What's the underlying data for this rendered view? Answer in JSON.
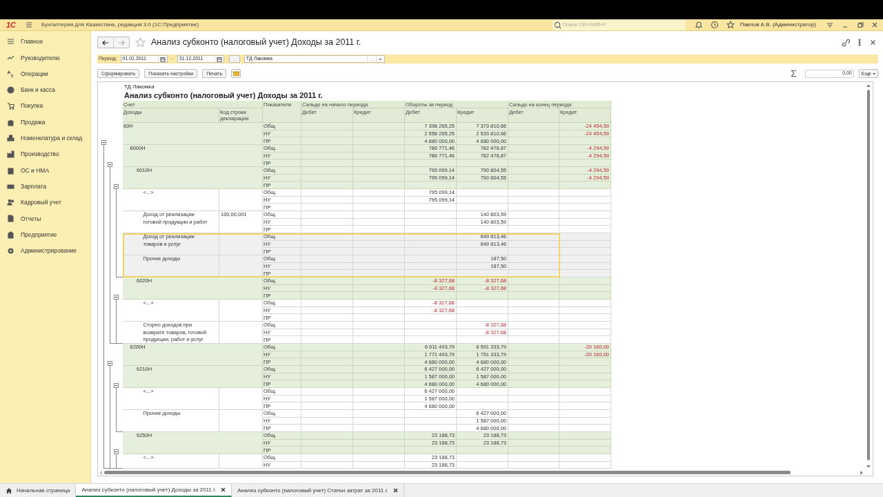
{
  "app": {
    "logo": "1С",
    "title": "Бухгалтерия для Казахстана, редакция 3.0  (1С:Предприятие)",
    "search_placeholder": "Поиск Ctrl+Shift+F",
    "user": "Павлов А.В. (Администратор)"
  },
  "sidebar": {
    "items": [
      {
        "label": "Главное"
      },
      {
        "label": "Руководителю"
      },
      {
        "label": "Операции"
      },
      {
        "label": "Банк и касса"
      },
      {
        "label": "Покупка"
      },
      {
        "label": "Продажа"
      },
      {
        "label": "Номенклатура и склад"
      },
      {
        "label": "Производство"
      },
      {
        "label": "ОС и НМА"
      },
      {
        "label": "Зарплата"
      },
      {
        "label": "Кадровый учет"
      },
      {
        "label": "Отчеты"
      },
      {
        "label": "Предприятие"
      },
      {
        "label": "Администрирование"
      }
    ]
  },
  "form": {
    "title": "Анализ субконто (налоговый учет) Доходы  за 2011 г.",
    "period_label": "Период:",
    "date_from": "01.01.2011",
    "date_separator": "-",
    "date_to": "31.12.2011",
    "period_button": "...",
    "subconto": "ТД Лакомка",
    "choose_glyph": "...",
    "clear_glyph": "×",
    "buttons": [
      "Сформировать",
      "Показать настройки",
      "Печать"
    ],
    "sum_value": "0,00",
    "more": "Еще"
  },
  "report": {
    "org": "ТД Лакомка",
    "title": "Анализ субконто (налоговый учет) Доходы  за 2011 г.",
    "header": {
      "account": "Счет",
      "name": "Доходы",
      "code": "Код строки декларации",
      "indicators": "Показатели",
      "sections": [
        {
          "title": "Сальдо на начало периода",
          "debit": "Дебет",
          "credit": "Кредит"
        },
        {
          "title": "Обороты за период",
          "debit": "Дебет",
          "credit": "Кредит"
        },
        {
          "title": "Сальдо на конец периода",
          "debit": "Дебет",
          "credit": "Кредит"
        }
      ]
    },
    "rows": [
      {
        "name": "60Н",
        "selected": false,
        "expanded": true,
        "lines": [
          {
            "label": "Общ.",
            "values": {
              "ob_d": "7 398 265,25",
              "ob_k": "7 373 810,66"
            },
            "red_values": {
              "sk_k": "-24 454,59"
            }
          },
          {
            "label": "НУ",
            "values": {
              "ob_d": "2 558 265,25",
              "ob_k": "2 533 810,66"
            },
            "red_values": {
              "sk_k": "-24 454,59"
            }
          },
          {
            "label": "ПР",
            "values": {
              "ob_d": "4 680 000,00",
              "ob_k": "4 680 000,00"
            }
          }
        ],
        "children": [
          {
            "name": "6000Н",
            "selected": false,
            "expanded": true,
            "lines": [
              {
                "label": "Общ.",
                "values": {
                  "ob_d": "786 771,46",
                  "ob_k": "782 476,87"
                },
                "red_values": {
                  "sk_k": "-4 294,59"
                }
              },
              {
                "label": "НУ",
                "values": {
                  "ob_d": "786 771,46",
                  "ob_k": "782 476,87"
                },
                "red_values": {
                  "sk_k": "-4 294,59"
                }
              },
              {
                "label": "ПР"
              }
            ],
            "children": [
              {
                "name": "6010Н",
                "selected": false,
                "expanded": true,
                "lines": [
                  {
                    "label": "Общ.",
                    "values": {
                      "ob_d": "795 099,14",
                      "ob_k": "790 804,55"
                    },
                    "red_values": {
                      "sk_k": "-4 294,59"
                    }
                  },
                  {
                    "label": "НУ",
                    "values": {
                      "ob_d": "795 099,14",
                      "ob_k": "790 804,55"
                    },
                    "red_values": {
                      "sk_k": "-4 294,59"
                    }
                  },
                  {
                    "label": "ПР"
                  }
                ],
                "children": [
                  {
                    "name": "<...>",
                    "selected": false,
                    "lines": [
                      {
                        "label": "Общ.",
                        "values": {
                          "ob_d": "795 099,14"
                        }
                      },
                      {
                        "label": "НУ",
                        "values": {
                          "ob_d": "795 099,14"
                        }
                      },
                      {
                        "label": "ПР"
                      }
                    ]
                  },
                  {
                    "name": "Доход от реализации готовой продукции и работ",
                    "code": "100.00.001",
                    "selected": false,
                    "lines": [
                      {
                        "label": "Общ.",
                        "values": {
                          "ob_k": "140 803,59"
                        }
                      },
                      {
                        "label": "НУ",
                        "values": {
                          "ob_k": "140 803,59"
                        }
                      },
                      {
                        "label": "ПР"
                      }
                    ]
                  },
                  {
                    "name": "Доход от реализации товаров и услуг",
                    "selected": true,
                    "lines": [
                      {
                        "label": "Общ.",
                        "values": {
                          "ob_k": "649 813,46"
                        }
                      },
                      {
                        "label": "НУ",
                        "values": {
                          "ob_k": "649 813,46"
                        }
                      },
                      {
                        "label": "ПР"
                      }
                    ]
                  },
                  {
                    "name": "Прочие доходы",
                    "selected": true,
                    "lines": [
                      {
                        "label": "Общ.",
                        "values": {
                          "ob_k": "187,50"
                        }
                      },
                      {
                        "label": "НУ",
                        "values": {
                          "ob_k": "187,50"
                        }
                      },
                      {
                        "label": "ПР"
                      }
                    ]
                  }
                ]
              },
              {
                "name": "6020Н",
                "selected": false,
                "expanded": true,
                "lines": [
                  {
                    "label": "Общ.",
                    "red_values": {
                      "ob_d": "-8 327,68",
                      "ob_k": "-8 327,68"
                    }
                  },
                  {
                    "label": "НУ",
                    "red_values": {
                      "ob_d": "-8 327,68",
                      "ob_k": "-8 327,68"
                    }
                  },
                  {
                    "label": "ПР"
                  }
                ],
                "children": [
                  {
                    "name": "<...>",
                    "selected": false,
                    "lines": [
                      {
                        "label": "Общ.",
                        "red_values": {
                          "ob_d": "-8 327,68"
                        }
                      },
                      {
                        "label": "НУ",
                        "red_values": {
                          "ob_d": "-8 327,68"
                        }
                      },
                      {
                        "label": "ПР"
                      }
                    ]
                  },
                  {
                    "name": "Сторно доходов при возврате товаров, готовой продукции, работ и услуг",
                    "selected": false,
                    "lines": [
                      {
                        "label": "Общ.",
                        "red_values": {
                          "ob_k": "-8 327,68"
                        }
                      },
                      {
                        "label": "НУ",
                        "red_values": {
                          "ob_k": "-8 327,68"
                        }
                      },
                      {
                        "label": "ПР"
                      }
                    ]
                  }
                ]
              }
            ]
          },
          {
            "name": "6200Н",
            "selected": false,
            "expanded": true,
            "lines": [
              {
                "label": "Общ.",
                "values": {
                  "ob_d": "6 611 493,79",
                  "ob_k": "6 591 333,79"
                },
                "red_values": {
                  "sk_k": "-20 160,00"
                }
              },
              {
                "label": "НУ",
                "values": {
                  "ob_d": "1 771 493,79",
                  "ob_k": "1 751 333,79"
                },
                "red_values": {
                  "sk_k": "-20 160,00"
                }
              },
              {
                "label": "ПР",
                "values": {
                  "ob_d": "4 680 000,00",
                  "ob_k": "4 680 000,00"
                }
              }
            ],
            "children": [
              {
                "name": "6210Н",
                "selected": false,
                "expanded": true,
                "lines": [
                  {
                    "label": "Общ.",
                    "values": {
                      "ob_d": "6 427 000,00",
                      "ob_k": "6 427 000,00"
                    }
                  },
                  {
                    "label": "НУ",
                    "values": {
                      "ob_d": "1 587 000,00",
                      "ob_k": "1 587 000,00"
                    }
                  },
                  {
                    "label": "ПР",
                    "values": {
                      "ob_d": "4 680 000,00",
                      "ob_k": "4 680 000,00"
                    }
                  }
                ],
                "children": [
                  {
                    "name": "<...>",
                    "selected": false,
                    "lines": [
                      {
                        "label": "Общ.",
                        "values": {
                          "ob_d": "6 427 000,00"
                        }
                      },
                      {
                        "label": "НУ",
                        "values": {
                          "ob_d": "1 587 000,00"
                        }
                      },
                      {
                        "label": "ПР",
                        "values": {
                          "ob_d": "4 680 000,00"
                        }
                      }
                    ]
                  },
                  {
                    "name": "Прочие доходы",
                    "selected": false,
                    "lines": [
                      {
                        "label": "Общ.",
                        "values": {
                          "ob_k": "6 427 000,00"
                        }
                      },
                      {
                        "label": "НУ",
                        "values": {
                          "ob_k": "1 587 000,00"
                        }
                      },
                      {
                        "label": "ПР",
                        "values": {
                          "ob_k": "4 680 000,00"
                        }
                      }
                    ]
                  }
                ]
              },
              {
                "name": "6250Н",
                "selected": false,
                "expanded": true,
                "lines": [
                  {
                    "label": "Общ.",
                    "values": {
                      "ob_d": "23 188,73",
                      "ob_k": "23 188,73"
                    }
                  },
                  {
                    "label": "НУ",
                    "values": {
                      "ob_d": "23 188,73",
                      "ob_k": "23 188,73"
                    }
                  },
                  {
                    "label": "ПР"
                  }
                ],
                "children": [
                  {
                    "name": "<...>",
                    "selected": false,
                    "lines": [
                      {
                        "label": "Общ.",
                        "values": {
                          "ob_d": "23 188,73"
                        }
                      },
                      {
                        "label": "НУ",
                        "values": {
                          "ob_d": "23 188,73"
                        }
                      }
                    ]
                  }
                ]
              }
            ]
          }
        ]
      }
    ]
  },
  "tabs": [
    {
      "label": "Начальная страница",
      "kind": "home",
      "selected": false
    },
    {
      "label": "Анализ субконто (налоговый учет) Доходы  за 2011 г.",
      "kind": "document",
      "selected": true
    },
    {
      "label": "Анализ субконто (налоговый учет) Статьи затрат  за 2011 г.",
      "kind": "document",
      "selected": false
    }
  ]
}
